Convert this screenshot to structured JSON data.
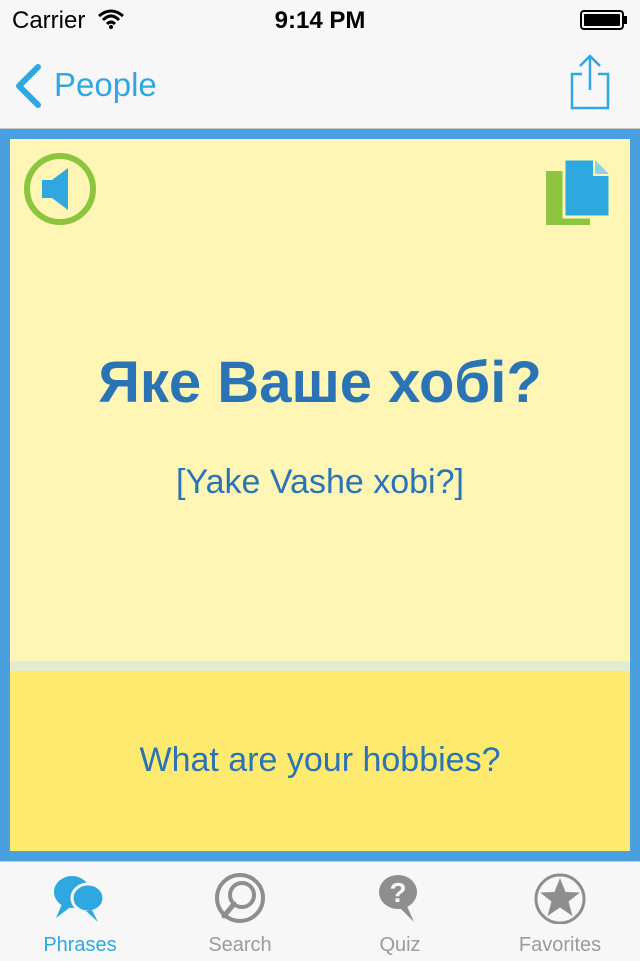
{
  "status_bar": {
    "carrier": "Carrier",
    "time": "9:14 PM"
  },
  "nav": {
    "back_label": "People",
    "share_icon": "share-icon"
  },
  "card": {
    "phrase": "Яке Ваше хобі?",
    "transliteration": "[Yake Vashe xobi?]",
    "translation": "What are your hobbies?"
  },
  "tabs": [
    {
      "label": "Phrases",
      "icon": "speech-bubbles-icon",
      "active": true
    },
    {
      "label": "Search",
      "icon": "magnifier-icon",
      "active": false
    },
    {
      "label": "Quiz",
      "icon": "question-bubble-icon",
      "active": false
    },
    {
      "label": "Favorites",
      "icon": "star-icon",
      "active": false
    }
  ],
  "colors": {
    "accent": "#2fa8e0",
    "frame": "#4a9fdf",
    "card_top": "#fff6b6",
    "card_bottom": "#ffea70",
    "text_blue": "#2a73b4",
    "speaker_ring": "#8cc63f"
  }
}
